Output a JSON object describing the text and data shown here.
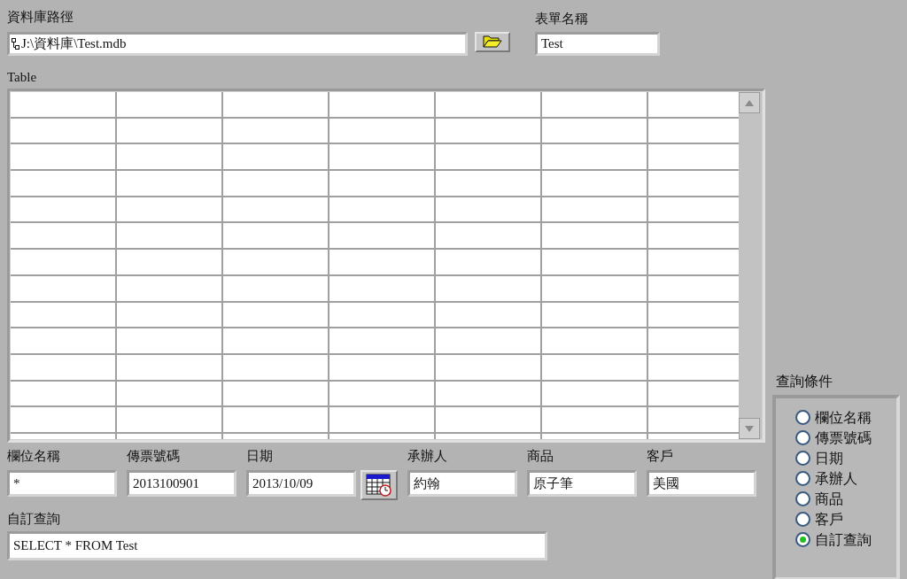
{
  "path_control": {
    "label": "資料庫路徑",
    "value": "J:\\資料庫\\Test.mdb"
  },
  "form_name": {
    "label": "表單名稱",
    "value": "Test"
  },
  "table": {
    "label": "Table"
  },
  "fields": [
    {
      "kind": "text",
      "label": "欄位名稱",
      "value": "*"
    },
    {
      "kind": "text",
      "label": "傳票號碼",
      "value": "2013100901"
    },
    {
      "kind": "date",
      "label": "日期",
      "value": "2013/10/09"
    },
    {
      "kind": "text",
      "label": "承辦人",
      "value": "約翰"
    },
    {
      "kind": "text",
      "label": "商品",
      "value": "原子筆"
    },
    {
      "kind": "text",
      "label": "客戶",
      "value": "美國"
    }
  ],
  "custom_query": {
    "label": "自訂查詢",
    "value": "SELECT * FROM Test"
  },
  "query_conditions": {
    "label": "查詢條件",
    "options": [
      {
        "label": "欄位名稱",
        "selected": false
      },
      {
        "label": "傳票號碼",
        "selected": false
      },
      {
        "label": "日期",
        "selected": false
      },
      {
        "label": "承辦人",
        "selected": false
      },
      {
        "label": "商品",
        "selected": false
      },
      {
        "label": "客戶",
        "selected": false
      },
      {
        "label": "自訂查詢",
        "selected": true
      }
    ]
  }
}
